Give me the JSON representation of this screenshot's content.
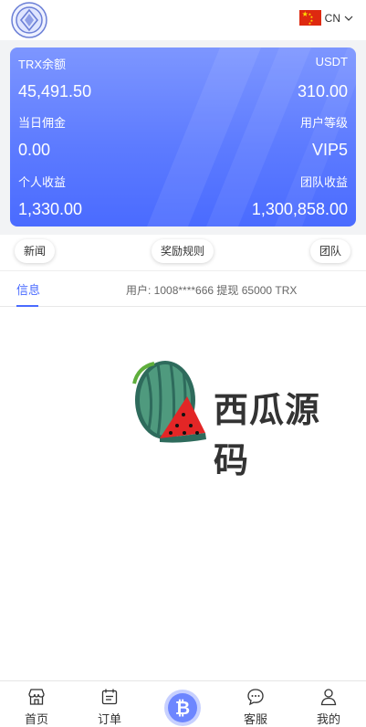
{
  "header": {
    "logo_icon": "coin-logo-icon",
    "language": "CN",
    "flag_icon": "china-flag-icon"
  },
  "card": {
    "trx_label": "TRX余额",
    "trx_value": "45,491.50",
    "usdt_label": "USDT",
    "usdt_value": "310.00",
    "commission_label": "当日佣金",
    "commission_value": "0.00",
    "level_label": "用户等级",
    "level_value": "VIP5",
    "personal_label": "个人收益",
    "personal_value": "1,330.00",
    "team_label": "团队收益",
    "team_value": "1,300,858.00",
    "gradient_top": "#7d96ff",
    "gradient_bottom": "#4a6bff"
  },
  "pills": {
    "news": "新闻",
    "rules": "奖励规则",
    "team": "团队"
  },
  "tabs": {
    "info": "信息",
    "notice": "用户: 1008****666 提现 65000 TRX"
  },
  "watermark": {
    "text": "西瓜源码"
  },
  "nav": {
    "home": "首页",
    "orders": "订单",
    "service": "客服",
    "mine": "我的",
    "center_icon": "bitcoin-icon"
  },
  "colors": {
    "accent": "#4a6bff"
  }
}
